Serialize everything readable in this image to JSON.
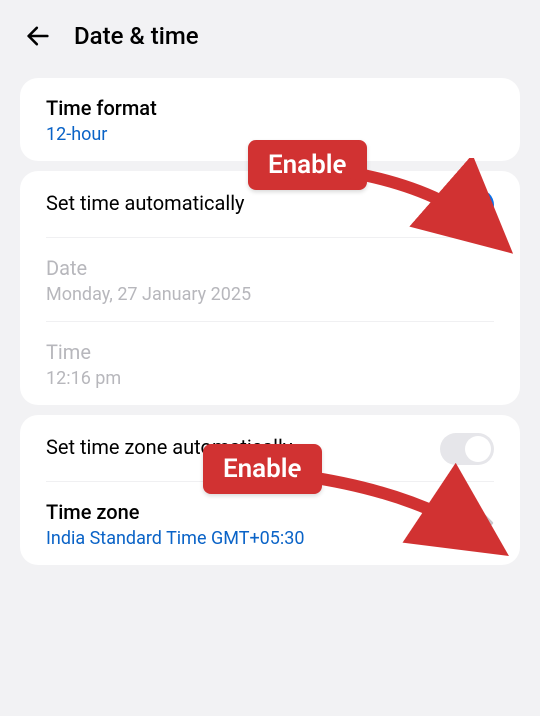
{
  "header": {
    "title": "Date & time"
  },
  "timeFormat": {
    "label": "Time format",
    "value": "12-hour"
  },
  "autoTime": {
    "label": "Set time automatically",
    "enabled": true
  },
  "date": {
    "label": "Date",
    "value": "Monday, 27 January 2025"
  },
  "time": {
    "label": "Time",
    "value": "12:16 pm"
  },
  "autoTimeZone": {
    "label": "Set time zone automatically",
    "enabled": false
  },
  "timeZone": {
    "label": "Time zone",
    "value": "India Standard Time GMT+05:30"
  },
  "annotation": {
    "label1": "Enable",
    "label2": "Enable"
  },
  "colors": {
    "accent": "#0a6fe6",
    "link": "#0a63c7",
    "callout": "#d13232"
  }
}
